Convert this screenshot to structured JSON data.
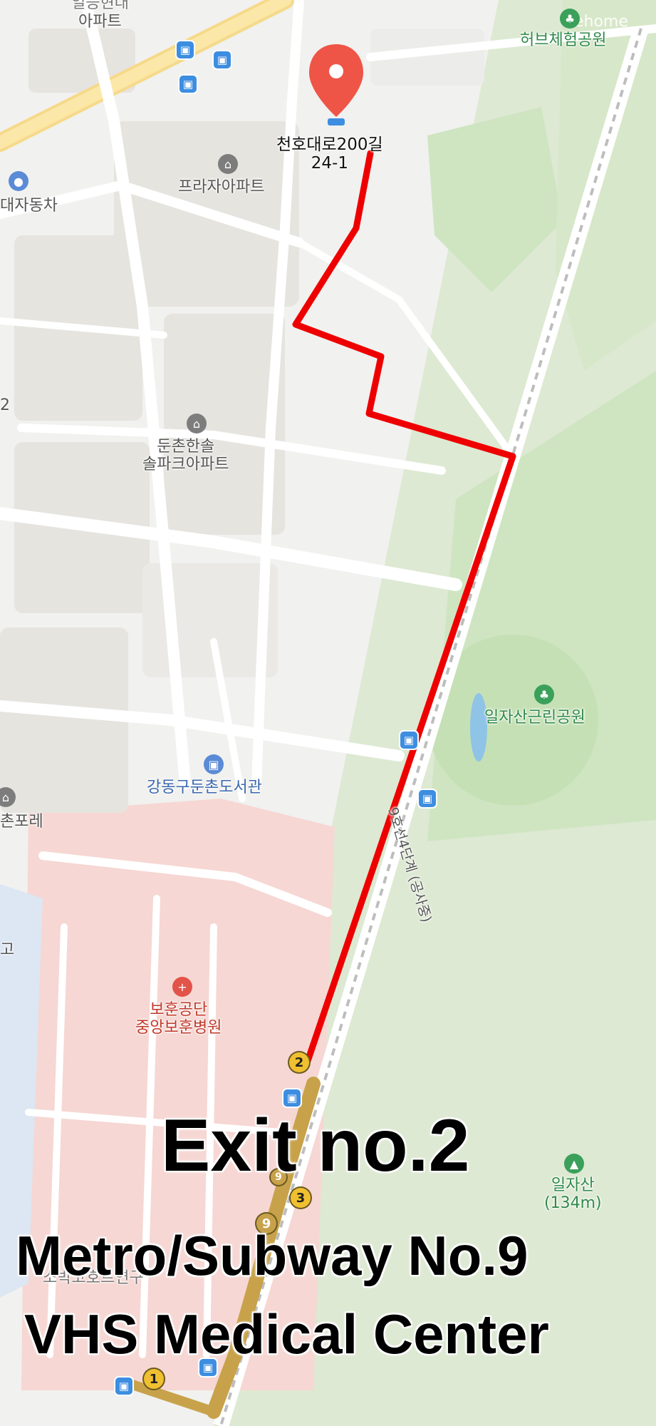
{
  "map": {
    "watermark": "wehome",
    "destination": {
      "line1": "천호대로200길",
      "line2": "24-1"
    },
    "places": {
      "apartment_top": "아파트",
      "apartment_top_partial": "일등현대",
      "hub_park": "허브체험공원",
      "plaza_apt": "프라자아파트",
      "car_dealer": "대자동차",
      "dunchon_apt_1": "둔촌한솔",
      "dunchon_apt_2": "솔파크아파트",
      "iljasan_park": "일자산근린공원",
      "library": "강동구둔촌도서관",
      "chonpore": "촌포레",
      "hospital_1": "보훈공단",
      "hospital_2": "중앙보훈병원",
      "iljasan": "일자산",
      "iljasan_height": "(134m)",
      "left_edge_1": "2",
      "left_edge_2": "고",
      "cohort_partial": "소박코호트연구",
      "rail_label": "9호선4단계 (공사중)"
    },
    "exits": [
      "1",
      "2",
      "3"
    ],
    "line_badge": "9",
    "line_badge_2": "9",
    "route_color": "#ee0000"
  },
  "overlay": {
    "exit": "Exit no.2",
    "line2": "Metro/Subway No.9",
    "line3": "VHS Medical Center"
  }
}
